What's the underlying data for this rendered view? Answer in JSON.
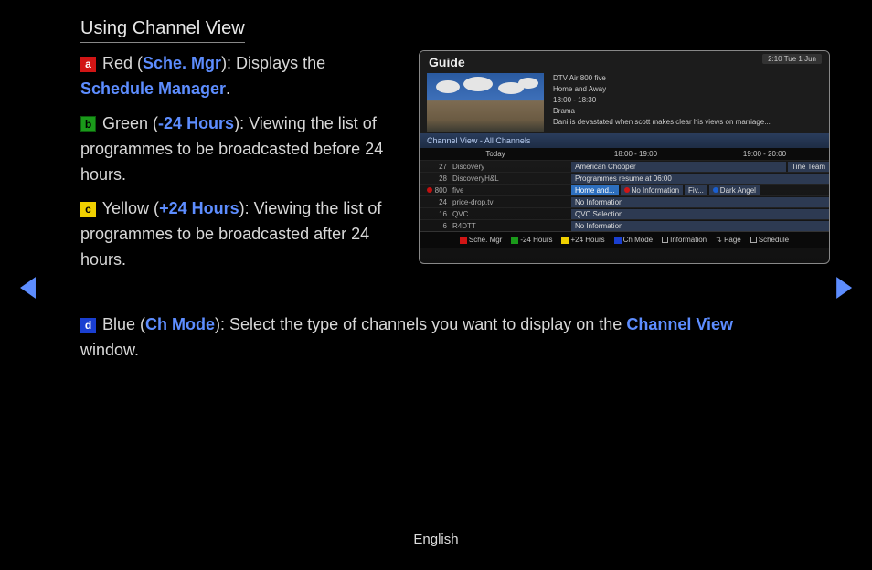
{
  "page": {
    "title": "Using Channel View",
    "language": "English"
  },
  "keys": {
    "a": "a",
    "b": "b",
    "c": "c",
    "d": "d"
  },
  "instr": {
    "red": {
      "prefix": "Red (",
      "label": "Sche. Mgr",
      "mid": "): Displays the ",
      "link": "Schedule Manager",
      "suffix": "."
    },
    "green": {
      "prefix": "Green (",
      "label": "-24 Hours",
      "suffix": "): Viewing the list of programmes to be broadcasted before 24 hours."
    },
    "yellow": {
      "prefix": "Yellow (",
      "label": "+24 Hours",
      "suffix": "): Viewing the list of programmes to be broadcasted after 24 hours."
    },
    "blue": {
      "prefix": "Blue (",
      "label": "Ch Mode",
      "mid": "): Select the type of channels you want to display on the ",
      "link": "Channel View",
      "suffix": " window."
    }
  },
  "guide": {
    "title": "Guide",
    "clock": "2:10 Tue 1 Jun",
    "meta": {
      "line1": "DTV Air 800 five",
      "line2": "Home and Away",
      "line3": "18:00 - 18:30",
      "line4": "Drama",
      "line5": "Dani is devastated when scott makes clear his views on marriage..."
    },
    "subheader": "Channel View - All Channels",
    "columns": {
      "today": "Today",
      "slot1": "18:00 - 19:00",
      "slot2": "19:00 - 20:00"
    },
    "rows": [
      {
        "num": "27",
        "name": "Discovery",
        "cells": [
          {
            "text": "American Chopper",
            "style": "cell-long"
          },
          {
            "text": "Tine Team",
            "style": ""
          }
        ]
      },
      {
        "num": "28",
        "name": "DiscoveryH&L",
        "cells": [
          {
            "text": "Programmes resume at 06:00",
            "style": "cell-long"
          }
        ]
      },
      {
        "num": "800",
        "name": "five",
        "rec": true,
        "cells": [
          {
            "text": "Home and...",
            "style": "cell-hl"
          },
          {
            "dot": "red",
            "text": "No Information"
          },
          {
            "text": "Fiv..."
          },
          {
            "dot": "blue",
            "text": "Dark Angel"
          }
        ]
      },
      {
        "num": "24",
        "name": "price-drop.tv",
        "cells": [
          {
            "text": "No Information",
            "style": "cell-long"
          }
        ]
      },
      {
        "num": "16",
        "name": "QVC",
        "cells": [
          {
            "text": "QVC Selection",
            "style": "cell-long"
          }
        ]
      },
      {
        "num": "6",
        "name": "R4DTT",
        "cells": [
          {
            "text": "No Information",
            "style": "cell-long"
          }
        ]
      }
    ],
    "legend": {
      "red": "Sche. Mgr",
      "green": "-24 Hours",
      "yellow": "+24 Hours",
      "blue": "Ch Mode",
      "info": "Information",
      "page": "Page",
      "schedule": "Schedule"
    }
  }
}
